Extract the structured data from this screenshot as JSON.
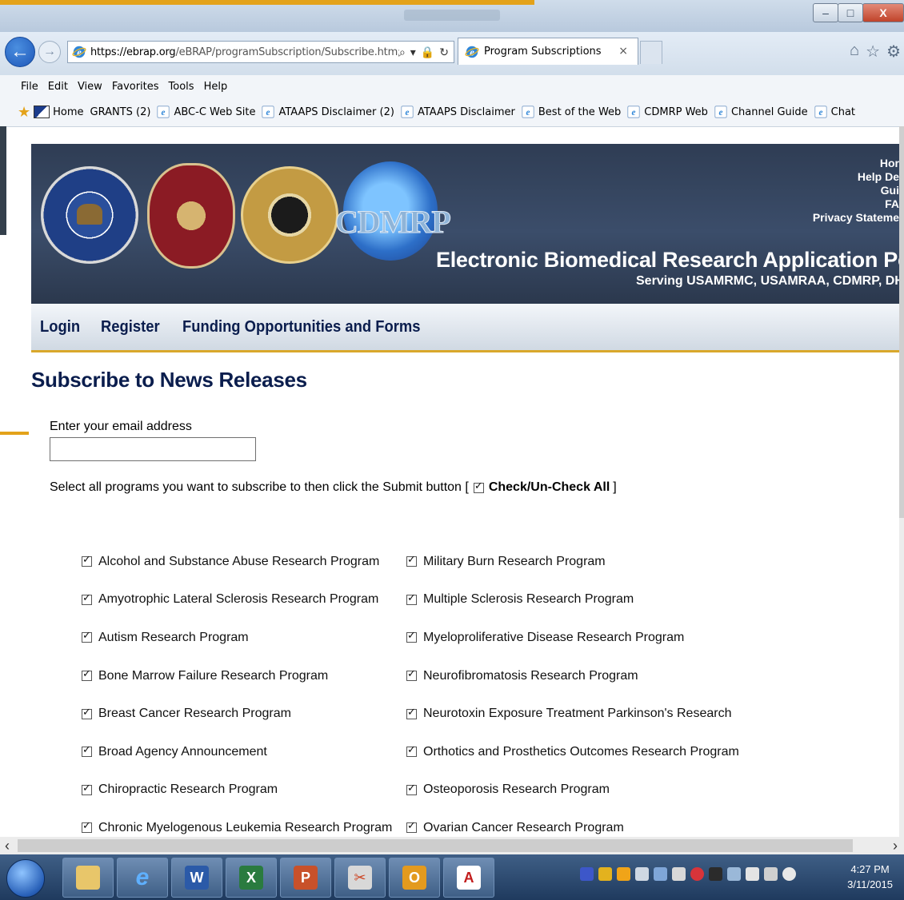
{
  "browser": {
    "url_host": "https://ebrap.org",
    "url_path": "/eBRAP/programSubscription/Subscribe.htm;js",
    "tab_title": "Program Subscriptions",
    "tab_close": "×",
    "menu": [
      "File",
      "Edit",
      "View",
      "Favorites",
      "Tools",
      "Help"
    ],
    "favorites": [
      {
        "label": "Home",
        "icon": "flag-icon"
      },
      {
        "label": "GRANTS (2)",
        "icon": "none"
      },
      {
        "label": "ABC-C Web Site",
        "icon": "ie-icon"
      },
      {
        "label": "ATAAPS Disclaimer (2)",
        "icon": "ie-icon"
      },
      {
        "label": "ATAAPS Disclaimer",
        "icon": "ie-icon"
      },
      {
        "label": "Best of the Web",
        "icon": "ie-icon"
      },
      {
        "label": "CDMRP Web",
        "icon": "ie-icon"
      },
      {
        "label": "Channel Guide",
        "icon": "ie-icon"
      },
      {
        "label": "Chat",
        "icon": "ie-icon"
      }
    ],
    "window_controls": {
      "minimize": "–",
      "maximize": "□",
      "close": "X"
    }
  },
  "header": {
    "logo_text": "CDMRP",
    "portal_title": "Electronic Biomedical Research Application Porta",
    "portal_subtitle": "Serving USAMRMC, USAMRAA, CDMRP, DH",
    "top_links": [
      "Hor",
      "Help De",
      "Gui",
      "FA",
      "Privacy Stateme"
    ]
  },
  "nav": {
    "items": [
      "Login",
      "Register",
      "Funding Opportunities and Forms"
    ]
  },
  "main": {
    "title": "Subscribe to News Releases",
    "email_label": "Enter your email address",
    "email_value": "",
    "select_prefix": "Select all programs you want to subscribe to then click the Submit button [",
    "check_all_label": "Check/Un-Check All",
    "select_suffix": "]",
    "programs_left": [
      "Alcohol and Substance Abuse Research Program",
      "Amyotrophic Lateral Sclerosis Research Program",
      "Autism Research Program",
      "Bone Marrow Failure Research Program",
      "Breast Cancer Research Program",
      "Broad Agency Announcement",
      "Chiropractic Research Program",
      "Chronic Myelogenous Leukemia Research Program"
    ],
    "programs_right": [
      "Military Burn Research Program",
      "Multiple Sclerosis Research Program",
      "Myeloproliferative Disease Research Program",
      "Neurofibromatosis Research Program",
      "Neurotoxin Exposure Treatment Parkinson's Research",
      "Orthotics and Prosthetics Outcomes Research Program",
      "Osteoporosis Research Program",
      "Ovarian Cancer Research Program"
    ],
    "all_checked": true
  },
  "taskbar": {
    "apps": [
      {
        "name": "explorer",
        "label": ""
      },
      {
        "name": "ie",
        "label": "e"
      },
      {
        "name": "word",
        "label": "W"
      },
      {
        "name": "excel",
        "label": "X"
      },
      {
        "name": "powerpoint",
        "label": "P"
      },
      {
        "name": "snipping",
        "label": "✂"
      },
      {
        "name": "outlook",
        "label": "O"
      },
      {
        "name": "acrobat",
        "label": "A"
      }
    ],
    "time": "4:27 PM",
    "date": "3/11/2015"
  },
  "colors": {
    "header_bg": "#34435c",
    "nav_text": "#0a1d4d",
    "accent_gold": "#d9a82b",
    "taskbar": "#2d4a70"
  }
}
